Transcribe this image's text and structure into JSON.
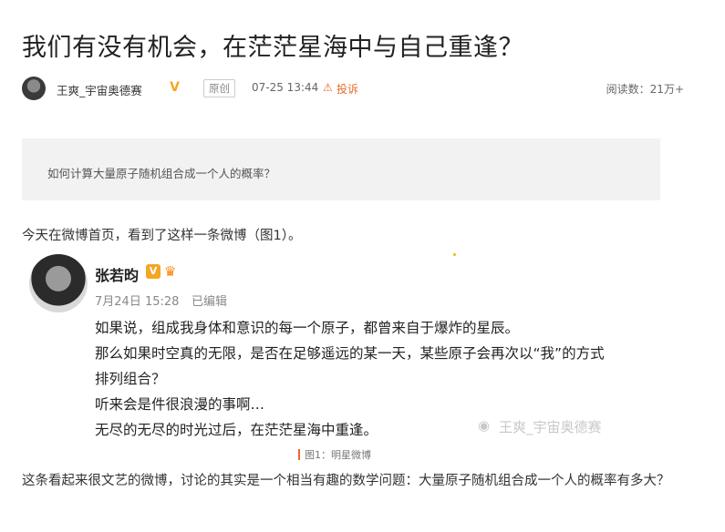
{
  "article": {
    "title": "我们有没有机会，在茫茫星海中与自己重逢？",
    "author": "王爽_宇宙奥德赛",
    "tag": "原创",
    "time": "07-25 13:44",
    "report": "投诉",
    "views_label": "阅读数：",
    "views_value": "21万+"
  },
  "question": {
    "text": "如何计算大量原子随机组合成一个人的概率？"
  },
  "body": {
    "paragraph1": "今天在微博首页，看到了这样一条微博（图1）。",
    "paragraph2": "这条看起来很文艺的微博，讨论的其实是一个相当有趣的数学问题：大量原子随机组合成一个人的概率有多大？"
  },
  "weibo_post": {
    "name": "张若昀",
    "vip_badge": "V",
    "date": "7月24日 15:28",
    "edited": "已编辑",
    "lines": [
      "如果说，组成我身体和意识的每一个原子，都曾来自于爆炸的星辰。",
      "那么如果时空真的无限，是否在足够遥远的某一天，某些原子会再次以“我”的方式",
      "排列组合？",
      "听来会是件很浪漫的事啊…",
      "无尽的无尽的时光过后，在茫茫星海中重逢。"
    ],
    "watermark": "王爽_宇宙奥德赛"
  },
  "figure_caption": "图1：明星微博",
  "icons": {
    "vip": "verified-v-icon",
    "crown": "crown-icon",
    "report": "warning-icon",
    "weibo_logo": "weibo-eye-icon"
  },
  "colors": {
    "accent": "#e86a2a",
    "vip": "#f5a623",
    "question_bg": "#f2f2f2"
  }
}
